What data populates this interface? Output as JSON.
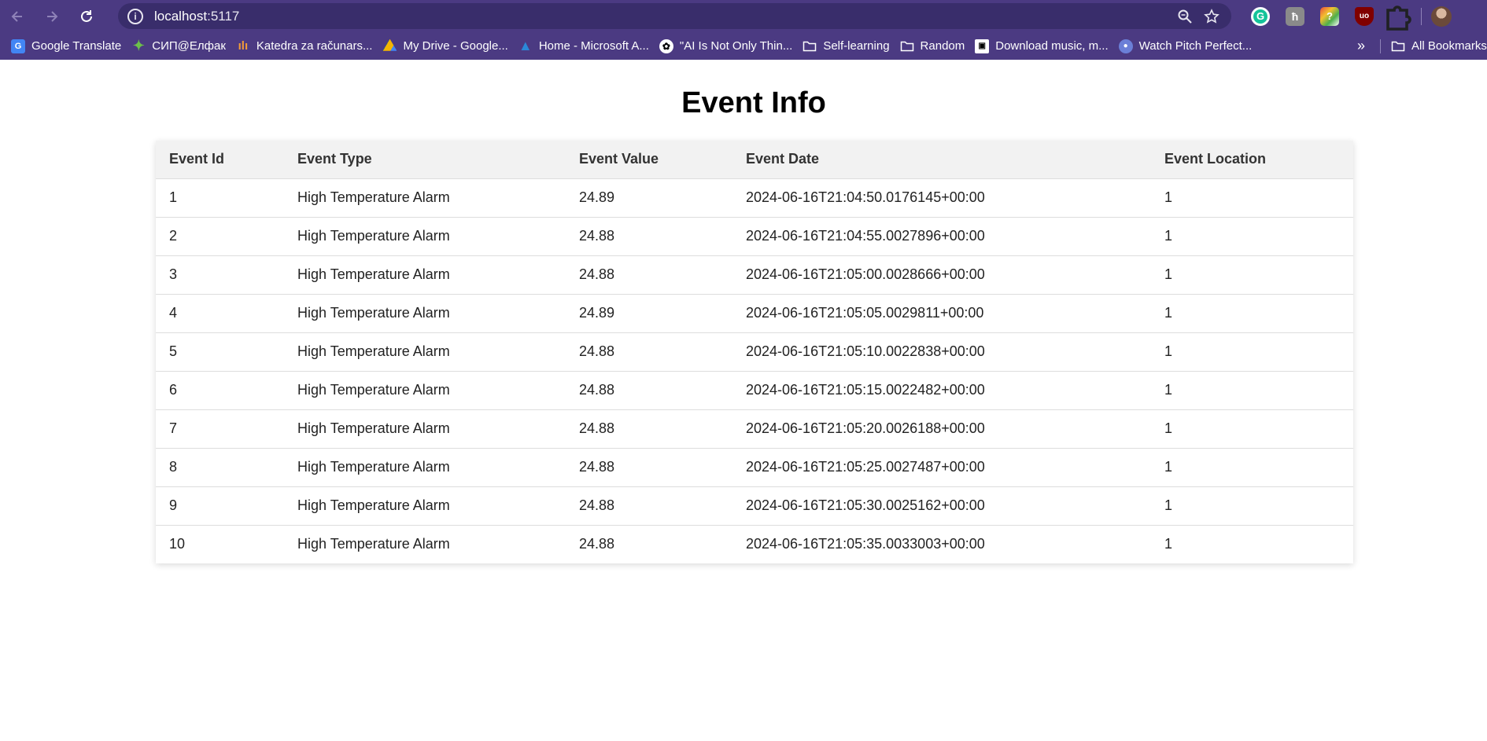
{
  "browser": {
    "url_host": "localhost",
    "url_port": ":5117",
    "bookmarks": [
      {
        "label": "Google Translate",
        "icon": "google-translate-icon"
      },
      {
        "label": "СИП@Елфак",
        "icon": "sip-elfak-icon"
      },
      {
        "label": "Katedra za računars...",
        "icon": "katedra-icon"
      },
      {
        "label": "My Drive - Google...",
        "icon": "google-drive-icon"
      },
      {
        "label": "Home - Microsoft A...",
        "icon": "microsoft-azure-icon"
      },
      {
        "label": "\"AI Is Not Only Thin...",
        "icon": "chatgpt-icon"
      },
      {
        "label": "Self-learning",
        "icon": "folder-icon"
      },
      {
        "label": "Random",
        "icon": "folder-icon"
      },
      {
        "label": "Download music, m...",
        "icon": "download-site-icon"
      },
      {
        "label": "Watch Pitch Perfect...",
        "icon": "watch-site-icon"
      }
    ],
    "all_bookmarks_label": "All Bookmarks"
  },
  "page": {
    "title": "Event Info"
  },
  "table": {
    "headers": [
      "Event Id",
      "Event Type",
      "Event Value",
      "Event Date",
      "Event Location"
    ],
    "rows": [
      [
        "1",
        "High Temperature Alarm",
        "24.89",
        "2024-06-16T21:04:50.0176145+00:00",
        "1"
      ],
      [
        "2",
        "High Temperature Alarm",
        "24.88",
        "2024-06-16T21:04:55.0027896+00:00",
        "1"
      ],
      [
        "3",
        "High Temperature Alarm",
        "24.88",
        "2024-06-16T21:05:00.0028666+00:00",
        "1"
      ],
      [
        "4",
        "High Temperature Alarm",
        "24.89",
        "2024-06-16T21:05:05.0029811+00:00",
        "1"
      ],
      [
        "5",
        "High Temperature Alarm",
        "24.88",
        "2024-06-16T21:05:10.0022838+00:00",
        "1"
      ],
      [
        "6",
        "High Temperature Alarm",
        "24.88",
        "2024-06-16T21:05:15.0022482+00:00",
        "1"
      ],
      [
        "7",
        "High Temperature Alarm",
        "24.88",
        "2024-06-16T21:05:20.0026188+00:00",
        "1"
      ],
      [
        "8",
        "High Temperature Alarm",
        "24.88",
        "2024-06-16T21:05:25.0027487+00:00",
        "1"
      ],
      [
        "9",
        "High Temperature Alarm",
        "24.88",
        "2024-06-16T21:05:30.0025162+00:00",
        "1"
      ],
      [
        "10",
        "High Temperature Alarm",
        "24.88",
        "2024-06-16T21:05:35.0033003+00:00",
        "1"
      ]
    ]
  },
  "colors": {
    "browser_frame": "#4b3a82",
    "omnibox": "#392d6b",
    "table_header_bg": "#f2f2f2",
    "row_border": "#dddddd"
  }
}
